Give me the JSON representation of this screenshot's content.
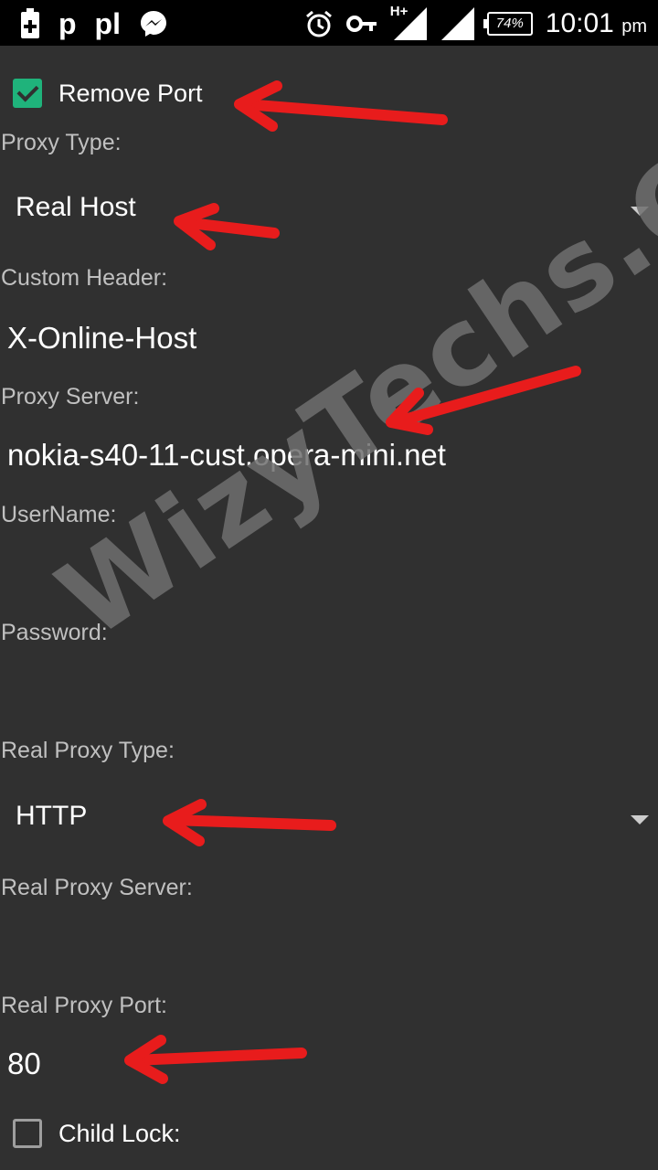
{
  "status_bar": {
    "left_icons": [
      "battery-saver-icon",
      "p-icon",
      "p-download-icon",
      "messenger-icon"
    ],
    "p_glyph": "p",
    "pl_glyph": "pl",
    "right_icons": [
      "alarm-icon",
      "key-icon",
      "signal-icon",
      "signal-2-icon"
    ],
    "network_type": "H+",
    "battery": "74%",
    "time": "10:01",
    "ampm": "pm"
  },
  "form": {
    "remove_port": {
      "label": "Remove Port",
      "checked": true
    },
    "proxy_type": {
      "label": "Proxy Type:",
      "value": "Real Host"
    },
    "custom_header": {
      "label": "Custom Header:",
      "value": "X-Online-Host"
    },
    "proxy_server": {
      "label": "Proxy Server:",
      "value": "nokia-s40-11-cust.opera-mini.net"
    },
    "username": {
      "label": "UserName:",
      "value": ""
    },
    "password": {
      "label": "Password:",
      "value": ""
    },
    "real_proxy_type": {
      "label": "Real Proxy Type:",
      "value": "HTTP"
    },
    "real_proxy_server": {
      "label": "Real Proxy Server:",
      "value": ""
    },
    "real_proxy_port": {
      "label": "Real Proxy Port:",
      "value": "80"
    },
    "child_lock": {
      "label": "Child Lock:",
      "checked": false
    }
  },
  "watermark": "WizyTechs.Com",
  "colors": {
    "background": "#303030",
    "accent": "#1fb37b",
    "arrow": "#e81c1c",
    "label": "#c0c0c0"
  }
}
